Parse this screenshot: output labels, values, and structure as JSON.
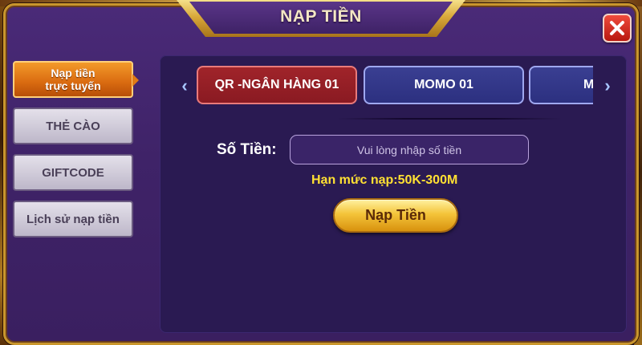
{
  "dialog": {
    "title": "NẠP TIỀN"
  },
  "sidebar": {
    "items": [
      {
        "label_line1": "Nạp tiền",
        "label_line2": "trực tuyến",
        "active": true
      },
      {
        "label": "THẺ CÀO"
      },
      {
        "label": "GIFTCODE"
      },
      {
        "label": "Lịch sử nạp tiền"
      }
    ]
  },
  "methods": {
    "tabs": [
      {
        "label": "QR -NGÂN HÀNG 01",
        "active": true
      },
      {
        "label": "MOMO 01"
      },
      {
        "label": "M"
      }
    ],
    "prev_icon": "chevron-left-icon",
    "next_icon": "chevron-right-icon"
  },
  "form": {
    "amount_label": "Số Tiền:",
    "amount_placeholder": "Vui lòng nhập số tiền",
    "amount_value": "",
    "limit_text": "Hạn mức nạp:50K-300M",
    "submit_label": "Nạp Tiền"
  },
  "colors": {
    "accent_gold": "#d9a93a",
    "active_side": "#e07a16",
    "active_tab": "#8a1a22",
    "tab_blue": "#2c3080",
    "limit_yellow": "#ffe033",
    "close_red": "#d12a1c"
  }
}
